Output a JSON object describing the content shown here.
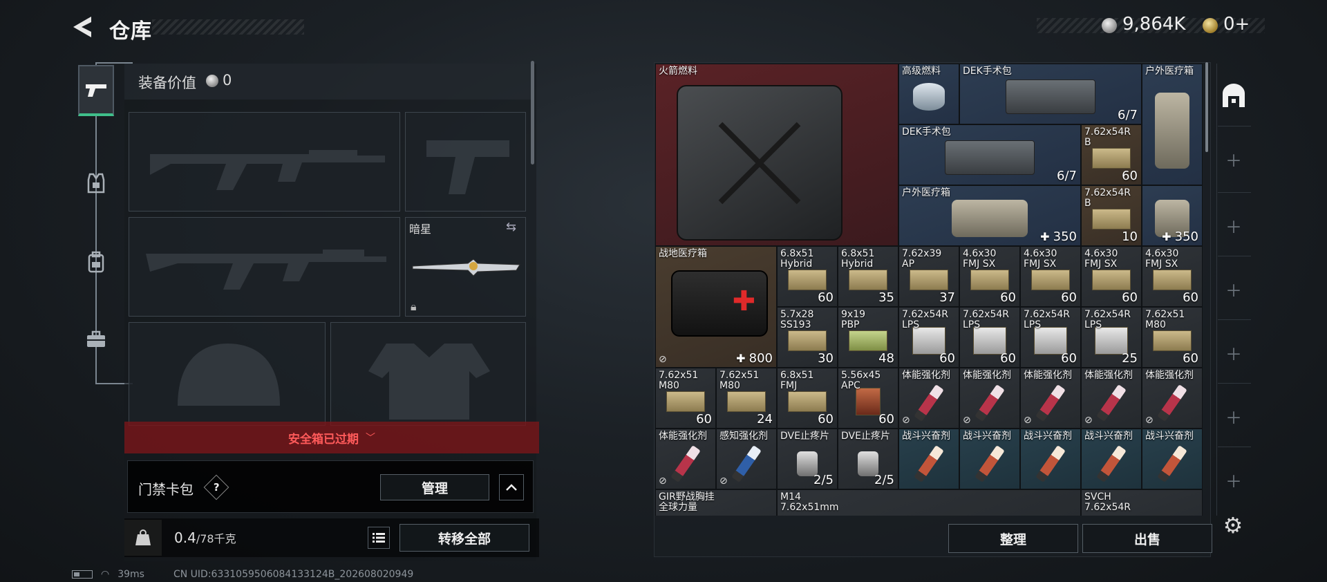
{
  "header": {
    "title": "仓库"
  },
  "currency": {
    "silver": "9,864K",
    "gold": "0+"
  },
  "nav": {
    "tabs": [
      "weapon",
      "armor",
      "backpack",
      "toolbox"
    ]
  },
  "equipment": {
    "value_label": "装备价值",
    "value": "0",
    "melee_name": "暗星",
    "safe_box_text": "安全箱已过期",
    "access_card_label": "门禁卡包",
    "help_label": "?",
    "manage_label": "管理",
    "weight_value": "0.4",
    "weight_max": "/78千克",
    "transfer_label": "转移全部"
  },
  "status": {
    "ping": "39ms",
    "uid": "CN UID:6331059506084133124B_202608020949"
  },
  "warehouse": {
    "items": [
      {
        "name": "火箭燃料",
        "count": "",
        "icon": "jerrycan",
        "bg": "bg-red"
      },
      {
        "name": "高级燃料",
        "count": "",
        "icon": "fuel-can",
        "bg": "bg-blue"
      },
      {
        "name": "DEK手术包",
        "count": "6/7",
        "icon": "surgery-kit",
        "bg": "bg-blue"
      },
      {
        "name": "户外医疗箱",
        "count": "",
        "icon": "outdoor-medkit",
        "bg": "bg-blue"
      },
      {
        "name": "DEK手术包",
        "count": "6/7",
        "icon": "surgery-kit",
        "bg": "bg-blue"
      },
      {
        "name": "7.62x54R\nB",
        "count": "60",
        "icon": "ammo-box",
        "bg": "bg-brown"
      },
      {
        "name": "户外医疗箱",
        "count": "350",
        "icon": "outdoor-medkit",
        "bg": "bg-blue"
      },
      {
        "name": "7.62x54R\nB",
        "count": "10",
        "icon": "ammo-box",
        "bg": "bg-brown"
      },
      {
        "name": "",
        "count": "350",
        "icon": "outdoor-medkit",
        "bg": "bg-blue"
      },
      {
        "name": "战地医疗箱",
        "count": "800",
        "icon": "first-aid-box",
        "bg": "bg-brown"
      },
      {
        "name": "6.8x51\nHybrid",
        "count": "60",
        "icon": "ammo-box",
        "bg": "bg-gray"
      },
      {
        "name": "6.8x51\nHybrid",
        "count": "35",
        "icon": "ammo-box",
        "bg": "bg-gray"
      },
      {
        "name": "7.62x39\nAP",
        "count": "37",
        "icon": "ammo-box",
        "bg": "bg-gray"
      },
      {
        "name": "4.6x30\nFMJ SX",
        "count": "60",
        "icon": "ammo-box",
        "bg": "bg-gray"
      },
      {
        "name": "4.6x30\nFMJ SX",
        "count": "60",
        "icon": "ammo-box",
        "bg": "bg-gray"
      },
      {
        "name": "4.6x30\nFMJ SX",
        "count": "60",
        "icon": "ammo-box",
        "bg": "bg-gray"
      },
      {
        "name": "4.6x30\nFMJ SX",
        "count": "60",
        "icon": "ammo-box",
        "bg": "bg-gray"
      },
      {
        "name": "5.7x28\nSS193",
        "count": "30",
        "icon": "ammo-box",
        "bg": "bg-gray"
      },
      {
        "name": "9x19\nPBP",
        "count": "48",
        "icon": "ammo-box-green",
        "bg": "bg-gray"
      },
      {
        "name": "7.62x54R\nLPS",
        "count": "60",
        "icon": "ammo-box-white",
        "bg": "bg-gray"
      },
      {
        "name": "7.62x54R\nLPS",
        "count": "60",
        "icon": "ammo-box-white",
        "bg": "bg-gray"
      },
      {
        "name": "7.62x54R\nLPS",
        "count": "60",
        "icon": "ammo-box-white",
        "bg": "bg-gray"
      },
      {
        "name": "7.62x54R\nLPS",
        "count": "25",
        "icon": "ammo-box-white",
        "bg": "bg-gray"
      },
      {
        "name": "7.62x51\nM80",
        "count": "60",
        "icon": "ammo-box",
        "bg": "bg-gray"
      },
      {
        "name": "7.62x51\nM80",
        "count": "60",
        "icon": "ammo-box",
        "bg": "bg-gray"
      },
      {
        "name": "7.62x51\nM80",
        "count": "24",
        "icon": "ammo-box",
        "bg": "bg-gray"
      },
      {
        "name": "6.8x51\nFMJ",
        "count": "60",
        "icon": "ammo-box",
        "bg": "bg-gray"
      },
      {
        "name": "5.56x45\nAPC",
        "count": "60",
        "icon": "ammo-box-red",
        "bg": "bg-gray"
      },
      {
        "name": "体能强化剂",
        "count": "",
        "icon": "syringe-red",
        "bg": "bg-gray"
      },
      {
        "name": "体能强化剂",
        "count": "",
        "icon": "syringe-red",
        "bg": "bg-gray"
      },
      {
        "name": "体能强化剂",
        "count": "",
        "icon": "syringe-red",
        "bg": "bg-gray"
      },
      {
        "name": "体能强化剂",
        "count": "",
        "icon": "syringe-red",
        "bg": "bg-gray"
      },
      {
        "name": "体能强化剂",
        "count": "",
        "icon": "syringe-red",
        "bg": "bg-gray"
      },
      {
        "name": "体能强化剂",
        "count": "",
        "icon": "syringe-red",
        "bg": "bg-gray"
      },
      {
        "name": "感知强化剂",
        "count": "",
        "icon": "syringe-blue",
        "bg": "bg-gray"
      },
      {
        "name": "DVE止疼片",
        "count": "2/5",
        "icon": "pill-bottle",
        "bg": "bg-gray"
      },
      {
        "name": "DVE止疼片",
        "count": "2/5",
        "icon": "pill-bottle",
        "bg": "bg-gray"
      },
      {
        "name": "战斗兴奋剂",
        "count": "",
        "icon": "syringe-orange",
        "bg": "bg-teal"
      },
      {
        "name": "战斗兴奋剂",
        "count": "",
        "icon": "syringe-orange",
        "bg": "bg-teal"
      },
      {
        "name": "战斗兴奋剂",
        "count": "",
        "icon": "syringe-orange",
        "bg": "bg-teal"
      },
      {
        "name": "战斗兴奋剂",
        "count": "",
        "icon": "syringe-orange",
        "bg": "bg-teal"
      },
      {
        "name": "战斗兴奋剂",
        "count": "",
        "icon": "syringe-orange",
        "bg": "bg-teal"
      },
      {
        "name": "GIR野战胸挂\n全球力量",
        "count": "",
        "icon": "chest-rig",
        "bg": "bg-gray"
      },
      {
        "name": "M14\n7.62x51mm",
        "count": "",
        "icon": "rifle",
        "bg": "bg-gray"
      },
      {
        "name": "SVCH\n7.62x54R",
        "count": "",
        "icon": "rifle",
        "bg": "bg-gray"
      }
    ],
    "sort_label": "整理",
    "sell_label": "出售"
  }
}
